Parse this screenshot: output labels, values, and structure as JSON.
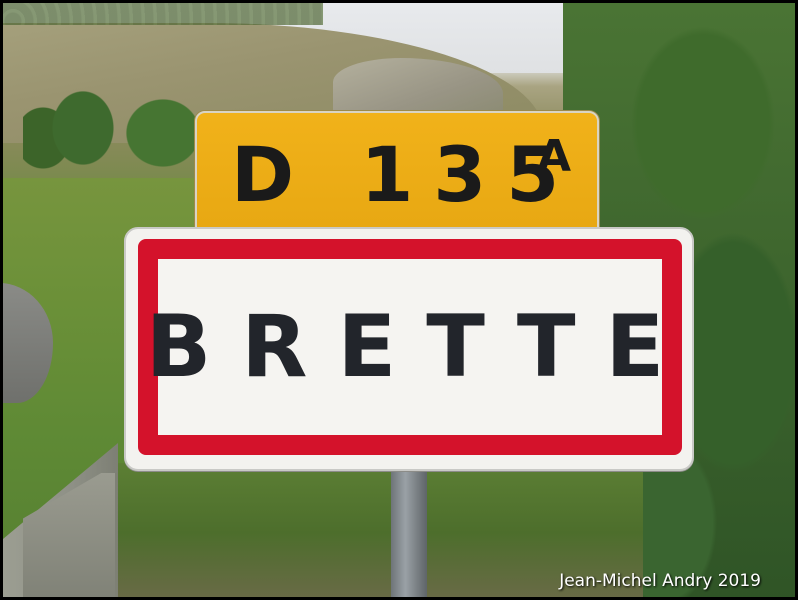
{
  "route_sign": {
    "number": "D 135",
    "suffix": "A",
    "background_color": "#f1b21a"
  },
  "town_sign": {
    "name": "BRETTE",
    "border_color": "#d4122b",
    "background_color": "#f5f4f1"
  },
  "credit": "Jean-Michel Andry 2019"
}
